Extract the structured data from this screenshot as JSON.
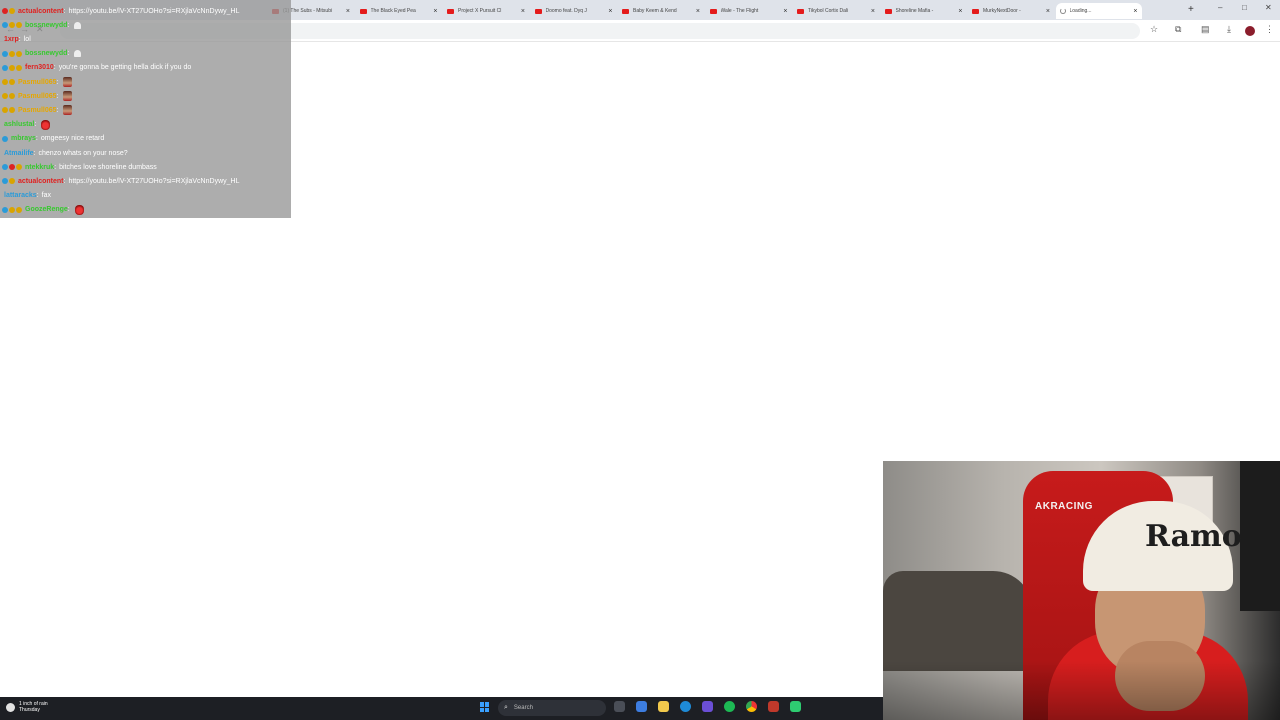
{
  "browser": {
    "tabs": [
      {
        "title": "(1) The Subs - Mitsubi",
        "active": false
      },
      {
        "title": "The Black Eyed Pea",
        "active": false
      },
      {
        "title": "Project X Pursuit Cl",
        "active": false
      },
      {
        "title": "Doomo feat. Dyq J",
        "active": false
      },
      {
        "title": "Baby Keem & Kend",
        "active": false
      },
      {
        "title": "Wale - The Flight",
        "active": false
      },
      {
        "title": "Tikybol Cortix Dali",
        "active": false
      },
      {
        "title": "Shoreline Mafia - ",
        "active": false
      },
      {
        "title": "MurkyNextDoor - ",
        "active": false
      },
      {
        "title": "Loading...",
        "active": true
      }
    ],
    "new_tab_label": "+",
    "close_label": "×"
  },
  "chat": {
    "messages": [
      {
        "user": "actualcontent",
        "user_color": "#e0201f",
        "badges": [
          "red",
          "gold"
        ],
        "text": "https://youtu.be/lV-XT27UOHo?si=RXjlaVcNnDywy_HL",
        "emote": ""
      },
      {
        "user": "bossnewydd",
        "user_color": "#37c92f",
        "badges": [
          "blue",
          "gold",
          "gold"
        ],
        "text": "",
        "emote": "ghost"
      },
      {
        "user": "1xrp",
        "user_color": "#e0201f",
        "badges": [],
        "text": "lol",
        "emote": ""
      },
      {
        "user": "bossnewydd",
        "user_color": "#37c92f",
        "badges": [
          "blue",
          "gold",
          "gold"
        ],
        "text": "",
        "emote": "ghost"
      },
      {
        "user": "fern3010",
        "user_color": "#e0201f",
        "badges": [
          "blue",
          "gold",
          "gold"
        ],
        "text": "you're gonna be getting hella dick if you do",
        "emote": ""
      },
      {
        "user": "Pasmull065",
        "user_color": "#e6a700",
        "badges": [
          "gold",
          "gold"
        ],
        "text": "",
        "emote": "girl"
      },
      {
        "user": "Pasmull065",
        "user_color": "#e6a700",
        "badges": [
          "gold",
          "gold"
        ],
        "text": "",
        "emote": "girl"
      },
      {
        "user": "Pasmull065",
        "user_color": "#e6a700",
        "badges": [
          "gold",
          "gold"
        ],
        "text": "",
        "emote": "girl"
      },
      {
        "user": "ashlustal",
        "user_color": "#37c92f",
        "badges": [],
        "text": "",
        "emote": "devil"
      },
      {
        "user": "mbrays",
        "user_color": "#37c92f",
        "badges": [
          "blue"
        ],
        "text": "omgeesy nice retard",
        "emote": ""
      },
      {
        "user": "Atmailife",
        "user_color": "#2b9bd8",
        "badges": [],
        "text": "chenzo whats on your nose?",
        "emote": ""
      },
      {
        "user": "ntekkruk",
        "user_color": "#37c92f",
        "badges": [
          "blue",
          "red",
          "gold"
        ],
        "text": "bitches love shoreline dumbass",
        "emote": ""
      },
      {
        "user": "actualcontent",
        "user_color": "#e0201f",
        "badges": [
          "blue",
          "gold"
        ],
        "text": "https://youtu.be/lV-XT27UOHo?si=RXjlaVcNnDywy_HL",
        "emote": ""
      },
      {
        "user": "lattaracks",
        "user_color": "#2b9bd8",
        "badges": [],
        "text": "fax",
        "emote": ""
      },
      {
        "user": "GoozeRenge",
        "user_color": "#37c92f",
        "badges": [
          "blue",
          "gold",
          "gold"
        ],
        "text": "",
        "emote": "devil"
      }
    ]
  },
  "webcam": {
    "chair_brand": "AKRACING",
    "cap_text": "Ramo"
  },
  "taskbar": {
    "weather_line1": "1 inch of rain",
    "weather_line2": "Thursday",
    "search_label": "Search"
  }
}
